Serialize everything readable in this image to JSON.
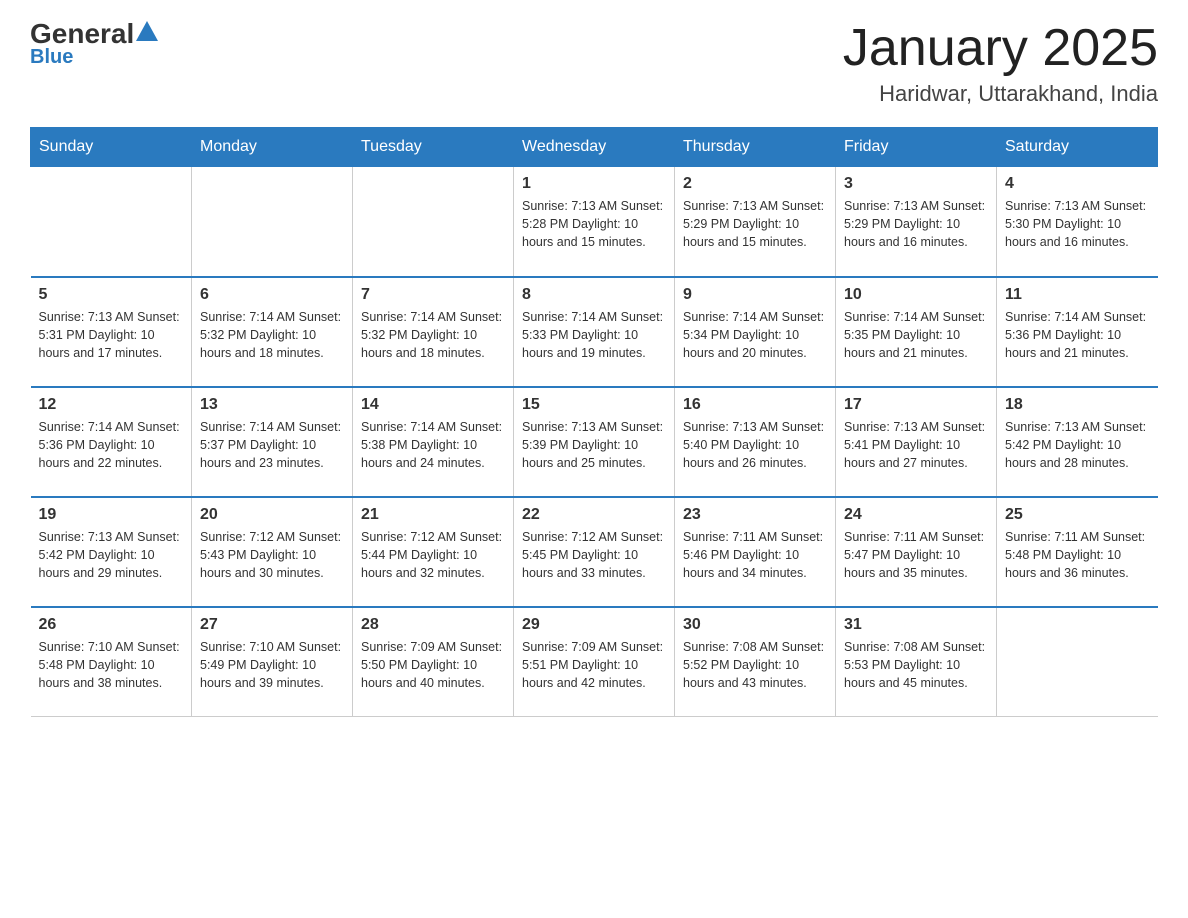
{
  "header": {
    "logo_general": "General",
    "logo_blue": "Blue",
    "title": "January 2025",
    "subtitle": "Haridwar, Uttarakhand, India"
  },
  "days_of_week": [
    "Sunday",
    "Monday",
    "Tuesday",
    "Wednesday",
    "Thursday",
    "Friday",
    "Saturday"
  ],
  "weeks": [
    [
      {
        "day": "",
        "info": ""
      },
      {
        "day": "",
        "info": ""
      },
      {
        "day": "",
        "info": ""
      },
      {
        "day": "1",
        "info": "Sunrise: 7:13 AM\nSunset: 5:28 PM\nDaylight: 10 hours\nand 15 minutes."
      },
      {
        "day": "2",
        "info": "Sunrise: 7:13 AM\nSunset: 5:29 PM\nDaylight: 10 hours\nand 15 minutes."
      },
      {
        "day": "3",
        "info": "Sunrise: 7:13 AM\nSunset: 5:29 PM\nDaylight: 10 hours\nand 16 minutes."
      },
      {
        "day": "4",
        "info": "Sunrise: 7:13 AM\nSunset: 5:30 PM\nDaylight: 10 hours\nand 16 minutes."
      }
    ],
    [
      {
        "day": "5",
        "info": "Sunrise: 7:13 AM\nSunset: 5:31 PM\nDaylight: 10 hours\nand 17 minutes."
      },
      {
        "day": "6",
        "info": "Sunrise: 7:14 AM\nSunset: 5:32 PM\nDaylight: 10 hours\nand 18 minutes."
      },
      {
        "day": "7",
        "info": "Sunrise: 7:14 AM\nSunset: 5:32 PM\nDaylight: 10 hours\nand 18 minutes."
      },
      {
        "day": "8",
        "info": "Sunrise: 7:14 AM\nSunset: 5:33 PM\nDaylight: 10 hours\nand 19 minutes."
      },
      {
        "day": "9",
        "info": "Sunrise: 7:14 AM\nSunset: 5:34 PM\nDaylight: 10 hours\nand 20 minutes."
      },
      {
        "day": "10",
        "info": "Sunrise: 7:14 AM\nSunset: 5:35 PM\nDaylight: 10 hours\nand 21 minutes."
      },
      {
        "day": "11",
        "info": "Sunrise: 7:14 AM\nSunset: 5:36 PM\nDaylight: 10 hours\nand 21 minutes."
      }
    ],
    [
      {
        "day": "12",
        "info": "Sunrise: 7:14 AM\nSunset: 5:36 PM\nDaylight: 10 hours\nand 22 minutes."
      },
      {
        "day": "13",
        "info": "Sunrise: 7:14 AM\nSunset: 5:37 PM\nDaylight: 10 hours\nand 23 minutes."
      },
      {
        "day": "14",
        "info": "Sunrise: 7:14 AM\nSunset: 5:38 PM\nDaylight: 10 hours\nand 24 minutes."
      },
      {
        "day": "15",
        "info": "Sunrise: 7:13 AM\nSunset: 5:39 PM\nDaylight: 10 hours\nand 25 minutes."
      },
      {
        "day": "16",
        "info": "Sunrise: 7:13 AM\nSunset: 5:40 PM\nDaylight: 10 hours\nand 26 minutes."
      },
      {
        "day": "17",
        "info": "Sunrise: 7:13 AM\nSunset: 5:41 PM\nDaylight: 10 hours\nand 27 minutes."
      },
      {
        "day": "18",
        "info": "Sunrise: 7:13 AM\nSunset: 5:42 PM\nDaylight: 10 hours\nand 28 minutes."
      }
    ],
    [
      {
        "day": "19",
        "info": "Sunrise: 7:13 AM\nSunset: 5:42 PM\nDaylight: 10 hours\nand 29 minutes."
      },
      {
        "day": "20",
        "info": "Sunrise: 7:12 AM\nSunset: 5:43 PM\nDaylight: 10 hours\nand 30 minutes."
      },
      {
        "day": "21",
        "info": "Sunrise: 7:12 AM\nSunset: 5:44 PM\nDaylight: 10 hours\nand 32 minutes."
      },
      {
        "day": "22",
        "info": "Sunrise: 7:12 AM\nSunset: 5:45 PM\nDaylight: 10 hours\nand 33 minutes."
      },
      {
        "day": "23",
        "info": "Sunrise: 7:11 AM\nSunset: 5:46 PM\nDaylight: 10 hours\nand 34 minutes."
      },
      {
        "day": "24",
        "info": "Sunrise: 7:11 AM\nSunset: 5:47 PM\nDaylight: 10 hours\nand 35 minutes."
      },
      {
        "day": "25",
        "info": "Sunrise: 7:11 AM\nSunset: 5:48 PM\nDaylight: 10 hours\nand 36 minutes."
      }
    ],
    [
      {
        "day": "26",
        "info": "Sunrise: 7:10 AM\nSunset: 5:48 PM\nDaylight: 10 hours\nand 38 minutes."
      },
      {
        "day": "27",
        "info": "Sunrise: 7:10 AM\nSunset: 5:49 PM\nDaylight: 10 hours\nand 39 minutes."
      },
      {
        "day": "28",
        "info": "Sunrise: 7:09 AM\nSunset: 5:50 PM\nDaylight: 10 hours\nand 40 minutes."
      },
      {
        "day": "29",
        "info": "Sunrise: 7:09 AM\nSunset: 5:51 PM\nDaylight: 10 hours\nand 42 minutes."
      },
      {
        "day": "30",
        "info": "Sunrise: 7:08 AM\nSunset: 5:52 PM\nDaylight: 10 hours\nand 43 minutes."
      },
      {
        "day": "31",
        "info": "Sunrise: 7:08 AM\nSunset: 5:53 PM\nDaylight: 10 hours\nand 45 minutes."
      },
      {
        "day": "",
        "info": ""
      }
    ]
  ]
}
